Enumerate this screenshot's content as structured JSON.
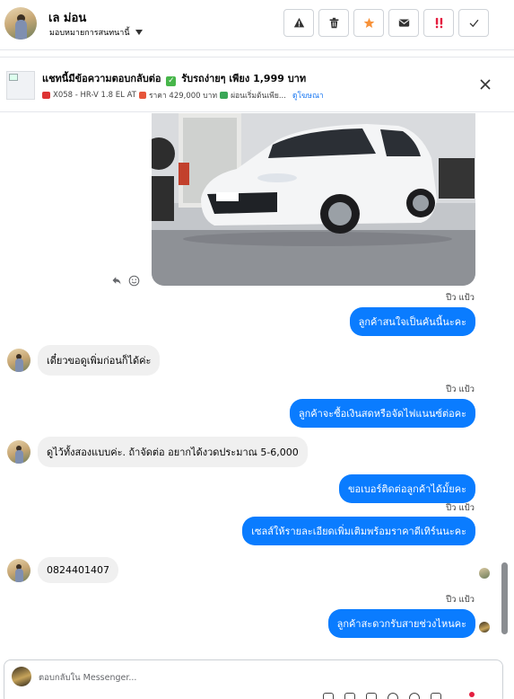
{
  "header": {
    "contact_name": "เล ม่อน",
    "assign_label": "มอบหมายการสนทนานี้"
  },
  "toolbar": [
    {
      "name": "report-button",
      "icon": "warning-icon"
    },
    {
      "name": "delete-button",
      "icon": "trash-icon"
    },
    {
      "name": "star-button",
      "icon": "star-icon",
      "color": "#f7923a"
    },
    {
      "name": "mark-unread-button",
      "icon": "envelope-icon"
    },
    {
      "name": "important-button",
      "icon": "exclamation-icon",
      "color": "#e41e3f"
    },
    {
      "name": "done-button",
      "icon": "check-icon"
    }
  ],
  "ad": {
    "title_part1": "แชทนี้มีข้อความตอบกลับต่อ",
    "title_part2": "รับรถง่ายๆ เพียง 1,999 บาท",
    "sub_model": "X058 - HR-V 1.8 EL AT",
    "sub_price": "ราคา 429,000 บาท",
    "sub_installment": "ผ่อนเริ่มต้นเพีย...",
    "view_ad": "ดูโฆษณา"
  },
  "messages": [
    {
      "type": "out",
      "time": "ปีว แป้ว",
      "text": "ลูกค้าสนใจเป็นคันนี้นะคะ"
    },
    {
      "type": "in",
      "text": "เดี๋ยวขอดูเพิ่มก่อนก็ได้ค่ะ"
    },
    {
      "type": "out",
      "time": "ปีว แป้ว",
      "text": "ลูกค้าจะซื้อเงินสดหรือจัดไฟแนนซ์ต่อคะ"
    },
    {
      "type": "in",
      "text": "ดูไว้ทั้งสองแบบค่ะ.  ถ้าจัดต่อ อยากได้งวดประมาณ 5-6,000"
    },
    {
      "type": "out",
      "text": "ขอเบอร์ติดต่อลูกค้าได้มั้ยคะ"
    },
    {
      "type": "out",
      "time": "ปีว แป้ว",
      "text": "เซลส์ให้รายละเอียดเพิ่มเติมพร้อมราคาดีเทิร์นนะคะ"
    },
    {
      "type": "in",
      "text": "0824401407"
    },
    {
      "type": "out",
      "time": "ปีว แป้ว",
      "text": "ลูกค้าสะดวกรับสายช่วงไหนคะ"
    }
  ],
  "composer": {
    "placeholder": "ตอบกลับใน Messenger..."
  }
}
